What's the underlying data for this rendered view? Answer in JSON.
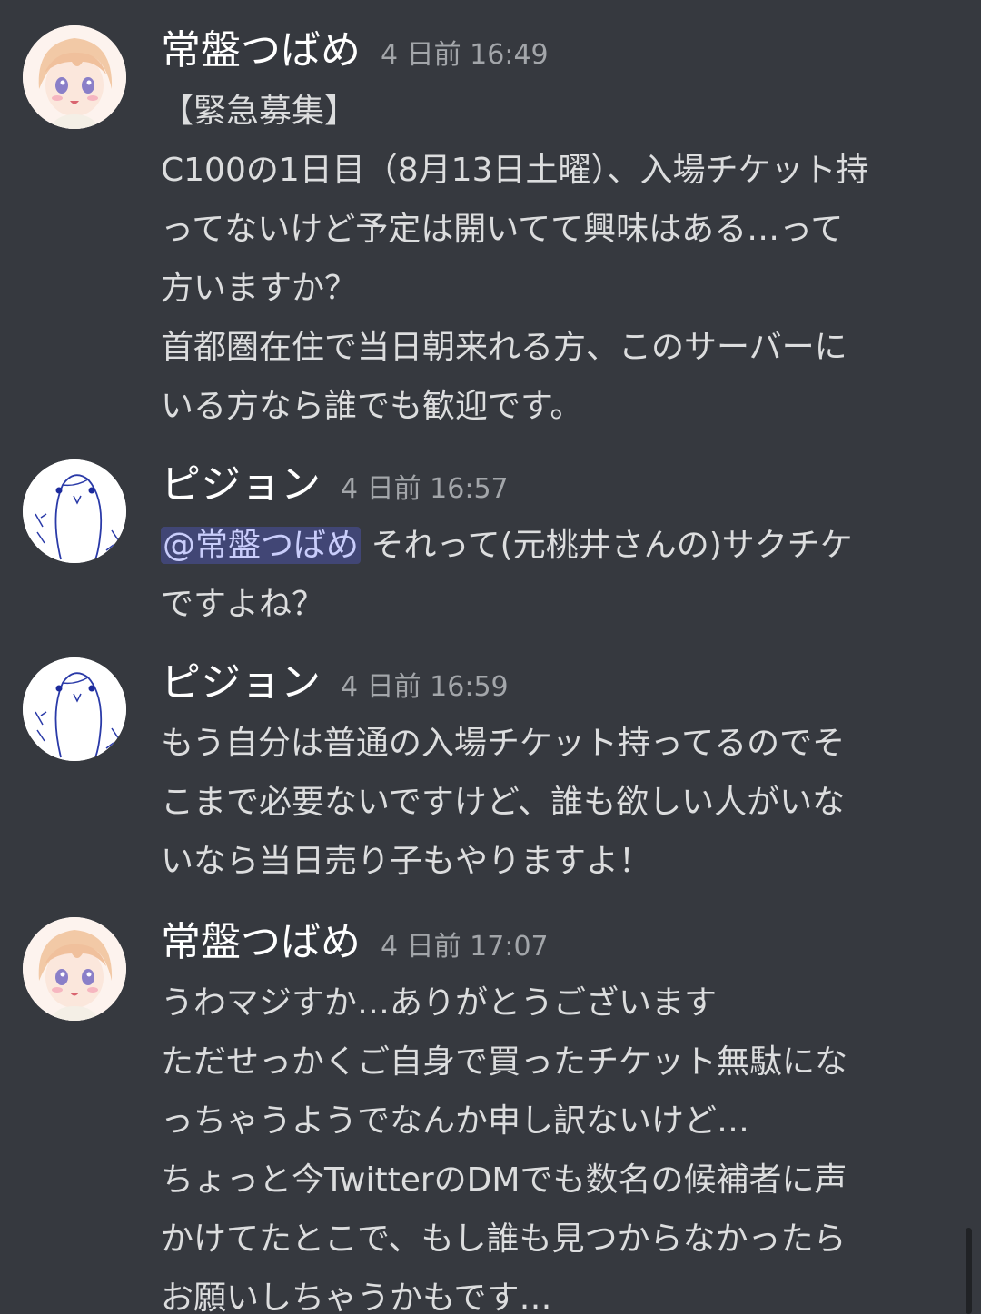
{
  "messages": [
    {
      "author": "常盤つばめ",
      "time": "4 日前 16:49",
      "avatar": "anime-girl-avatar",
      "lines": [
        "【緊急募集】",
        "C100の1日目（8月13日土曜）、入場チケット持",
        "ってないけど予定は開いてて興味はある…って",
        "方いますか？",
        "首都圏在住で当日朝来れる方、このサーバーに",
        "いる方なら誰でも歓迎です。"
      ]
    },
    {
      "author": "ピジョン",
      "time": "4 日前 16:57",
      "avatar": "bird-avatar",
      "mention": "@常盤つばめ",
      "mention_rest": " それって(元桃井さんの)サクチケ",
      "lines": [
        "ですよね？"
      ]
    },
    {
      "author": "ピジョン",
      "time": "4 日前 16:59",
      "avatar": "bird-avatar",
      "lines": [
        "もう自分は普通の入場チケット持ってるのでそ",
        "こまで必要ないですけど、誰も欲しい人がいな",
        "いなら当日売り子もやりますよ！"
      ]
    },
    {
      "author": "常盤つばめ",
      "time": "4 日前 17:07",
      "avatar": "anime-girl-avatar",
      "lines": [
        "うわマジすか…ありがとうございます",
        "ただせっかくご自身で買ったチケット無駄にな",
        "っちゃうようでなんか申し訳ないけど…",
        "ちょっと今TwitterのDMでも数名の候補者に声",
        "かけてたとこで、もし誰も見つからなかったら",
        "お願いしちゃうかもです…"
      ]
    }
  ],
  "colors": {
    "background": "#36393f",
    "username": "#ffffff",
    "timestamp": "#a3a6aa",
    "text": "#dcddde",
    "mention_bg": "#414675",
    "mention_text": "#c9cdfb"
  }
}
